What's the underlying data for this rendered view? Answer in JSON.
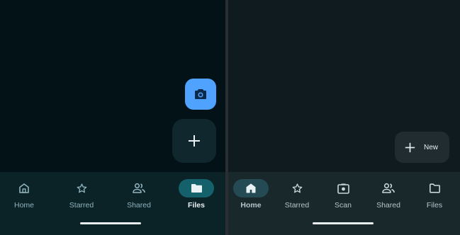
{
  "left_screen": {
    "nav": [
      {
        "label": "Home",
        "icon": "home-icon",
        "active": false
      },
      {
        "label": "Starred",
        "icon": "star-icon",
        "active": false
      },
      {
        "label": "Shared",
        "icon": "people-icon",
        "active": false
      },
      {
        "label": "Files",
        "icon": "folder-icon",
        "active": true
      }
    ]
  },
  "right_screen": {
    "new_button_label": "New",
    "nav": [
      {
        "label": "Home",
        "icon": "home-icon",
        "active": true
      },
      {
        "label": "Starred",
        "icon": "star-icon",
        "active": false
      },
      {
        "label": "Scan",
        "icon": "scan-camera-icon",
        "active": false
      },
      {
        "label": "Shared",
        "icon": "people-icon",
        "active": false
      },
      {
        "label": "Files",
        "icon": "folder-icon",
        "active": false
      }
    ]
  },
  "colors": {
    "accent_blue": "#4fa3ff",
    "left_background": "#031217",
    "right_background": "#0f1b1e",
    "active_pill_left": "#14616c",
    "active_pill_right": "#244b54"
  }
}
